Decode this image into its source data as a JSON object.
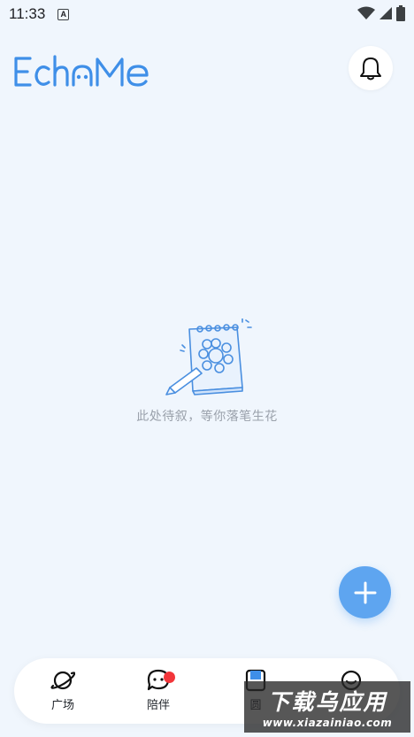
{
  "status_bar": {
    "time": "11:33",
    "notification_badge": "A",
    "icons": [
      "wifi-icon",
      "signal-icon",
      "battery-icon"
    ]
  },
  "header": {
    "logo_text": "EchoMe",
    "bell_icon": "bell-icon"
  },
  "empty_state": {
    "illustration": "notebook-pencil-illustration",
    "message": "此处待叙，等你落笔生花"
  },
  "fab": {
    "icon": "plus-icon"
  },
  "tabs": [
    {
      "label": "广场",
      "icon": "planet-icon",
      "badge": false
    },
    {
      "label": "陪伴",
      "icon": "chat-bubble-icon",
      "badge": true
    },
    {
      "label": "圆",
      "icon": "notebook-icon",
      "badge": false
    },
    {
      "label": "",
      "icon": "smile-icon",
      "badge": false
    }
  ],
  "watermark": {
    "title": "下载乌应用",
    "url": "www.xiazainiao.com"
  },
  "colors": {
    "background": "#f0f6fd",
    "accent": "#5ea5f0",
    "badge": "#f2353a"
  }
}
